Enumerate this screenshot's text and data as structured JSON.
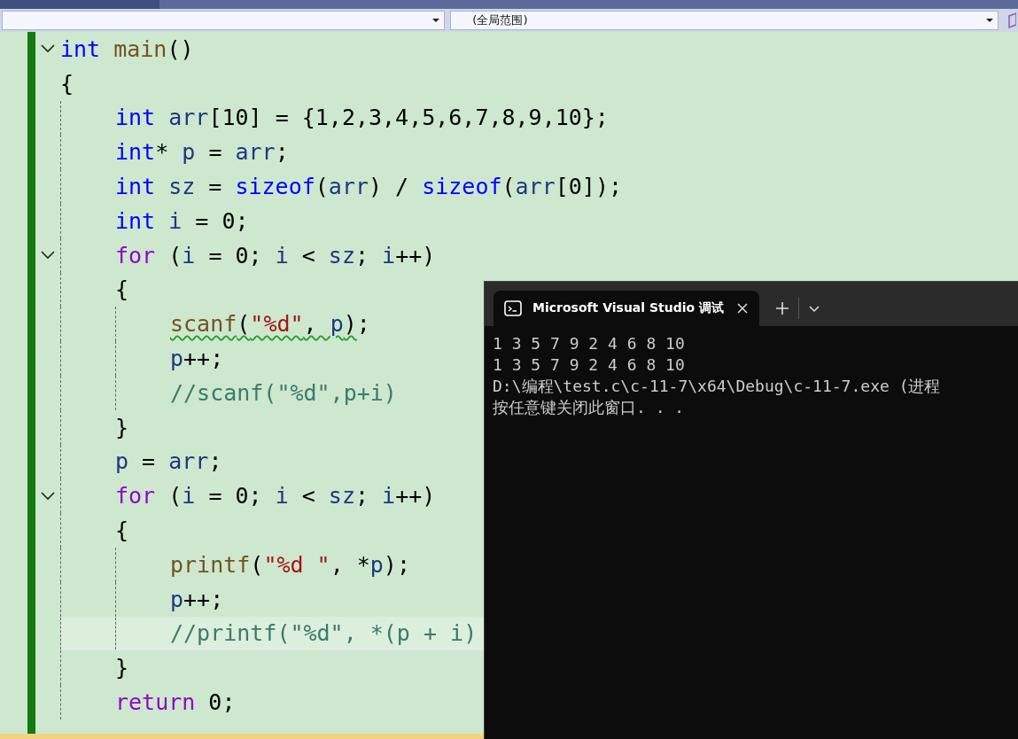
{
  "navigation_bar": {
    "scope_dropdown": {
      "value": "(全局范围)"
    }
  },
  "editor": {
    "lines": [
      {
        "fold": true,
        "current": false,
        "tokens": [
          {
            "kind": "keyword",
            "text": "int"
          },
          {
            "kind": "function",
            "text": " main"
          },
          {
            "kind": "plain",
            "text": "()"
          }
        ]
      },
      {
        "fold": false,
        "current": false,
        "tokens": [
          {
            "kind": "plain",
            "text": "{"
          }
        ],
        "children": [
          {
            "fold": false,
            "current": false,
            "tokens": [
              {
                "kind": "keyword",
                "text": "int"
              },
              {
                "kind": "variable",
                "text": " arr"
              },
              {
                "kind": "plain",
                "text": "[10] = {1,2,3,4,5,6,7,8,9,10};"
              }
            ]
          },
          {
            "fold": false,
            "current": false,
            "tokens": [
              {
                "kind": "keyword",
                "text": "int"
              },
              {
                "kind": "plain",
                "text": "* "
              },
              {
                "kind": "variable",
                "text": "p"
              },
              {
                "kind": "plain",
                "text": " = "
              },
              {
                "kind": "variable",
                "text": "arr"
              },
              {
                "kind": "plain",
                "text": ";"
              }
            ]
          },
          {
            "fold": false,
            "current": false,
            "tokens": [
              {
                "kind": "keyword",
                "text": "int"
              },
              {
                "kind": "variable",
                "text": " sz"
              },
              {
                "kind": "plain",
                "text": " = "
              },
              {
                "kind": "keyword",
                "text": "sizeof"
              },
              {
                "kind": "plain",
                "text": "("
              },
              {
                "kind": "variable",
                "text": "arr"
              },
              {
                "kind": "plain",
                "text": ") / "
              },
              {
                "kind": "keyword",
                "text": "sizeof"
              },
              {
                "kind": "plain",
                "text": "("
              },
              {
                "kind": "variable",
                "text": "arr"
              },
              {
                "kind": "plain",
                "text": "[0]);"
              }
            ]
          },
          {
            "fold": false,
            "current": false,
            "tokens": [
              {
                "kind": "keyword",
                "text": "int"
              },
              {
                "kind": "variable",
                "text": " i"
              },
              {
                "kind": "plain",
                "text": " = 0;"
              }
            ]
          },
          {
            "fold": true,
            "current": false,
            "tokens": [
              {
                "kind": "control",
                "text": "for"
              },
              {
                "kind": "plain",
                "text": " ("
              },
              {
                "kind": "variable",
                "text": "i"
              },
              {
                "kind": "plain",
                "text": " = 0; "
              },
              {
                "kind": "variable",
                "text": "i"
              },
              {
                "kind": "plain",
                "text": " < "
              },
              {
                "kind": "variable",
                "text": "sz"
              },
              {
                "kind": "plain",
                "text": "; "
              },
              {
                "kind": "variable",
                "text": "i"
              },
              {
                "kind": "plain",
                "text": "++)"
              }
            ]
          },
          {
            "fold": false,
            "current": false,
            "tokens": [
              {
                "kind": "plain",
                "text": "{"
              }
            ],
            "children": [
              {
                "fold": false,
                "current": false,
                "tokens": [
                  {
                    "kind": "function",
                    "text": "scanf",
                    "squiggle": true
                  },
                  {
                    "kind": "plain",
                    "text": "(",
                    "squiggle": true
                  },
                  {
                    "kind": "string",
                    "text": "\"%d\"",
                    "squiggle": true
                  },
                  {
                    "kind": "plain",
                    "text": ", ",
                    "squiggle": true
                  },
                  {
                    "kind": "variable",
                    "text": "p",
                    "squiggle": true
                  },
                  {
                    "kind": "plain",
                    "text": ")",
                    "squiggle": true
                  },
                  {
                    "kind": "plain",
                    "text": ";",
                    "squiggle": false
                  }
                ]
              },
              {
                "fold": false,
                "current": false,
                "tokens": [
                  {
                    "kind": "variable",
                    "text": "p"
                  },
                  {
                    "kind": "plain",
                    "text": "++;"
                  }
                ]
              },
              {
                "fold": false,
                "current": false,
                "tokens": [
                  {
                    "kind": "comment",
                    "text": "//scanf(\"%d\",p+i)"
                  }
                ]
              }
            ]
          },
          {
            "fold": false,
            "current": false,
            "tokens": [
              {
                "kind": "plain",
                "text": "}"
              }
            ]
          },
          {
            "fold": false,
            "current": false,
            "tokens": [
              {
                "kind": "variable",
                "text": "p"
              },
              {
                "kind": "plain",
                "text": " = "
              },
              {
                "kind": "variable",
                "text": "arr"
              },
              {
                "kind": "plain",
                "text": ";"
              }
            ]
          },
          {
            "fold": true,
            "current": false,
            "tokens": [
              {
                "kind": "control",
                "text": "for"
              },
              {
                "kind": "plain",
                "text": " ("
              },
              {
                "kind": "variable",
                "text": "i"
              },
              {
                "kind": "plain",
                "text": " = 0; "
              },
              {
                "kind": "variable",
                "text": "i"
              },
              {
                "kind": "plain",
                "text": " < "
              },
              {
                "kind": "variable",
                "text": "sz"
              },
              {
                "kind": "plain",
                "text": "; "
              },
              {
                "kind": "variable",
                "text": "i"
              },
              {
                "kind": "plain",
                "text": "++)"
              }
            ]
          },
          {
            "fold": false,
            "current": false,
            "tokens": [
              {
                "kind": "plain",
                "text": "{"
              }
            ],
            "children": [
              {
                "fold": false,
                "current": false,
                "tokens": [
                  {
                    "kind": "function",
                    "text": "printf"
                  },
                  {
                    "kind": "plain",
                    "text": "("
                  },
                  {
                    "kind": "string",
                    "text": "\"%d \""
                  },
                  {
                    "kind": "plain",
                    "text": ", *"
                  },
                  {
                    "kind": "variable",
                    "text": "p"
                  },
                  {
                    "kind": "plain",
                    "text": ");"
                  }
                ]
              },
              {
                "fold": false,
                "current": false,
                "tokens": [
                  {
                    "kind": "variable",
                    "text": "p"
                  },
                  {
                    "kind": "plain",
                    "text": "++;"
                  }
                ]
              },
              {
                "fold": false,
                "current": true,
                "tokens": [
                  {
                    "kind": "comment",
                    "text": "//printf(\"%d\", *(p + i)"
                  }
                ]
              }
            ]
          },
          {
            "fold": false,
            "current": false,
            "tokens": [
              {
                "kind": "plain",
                "text": "}"
              }
            ]
          },
          {
            "fold": false,
            "current": false,
            "tokens": [
              {
                "kind": "control",
                "text": "return"
              },
              {
                "kind": "plain",
                "text": " 0;"
              }
            ]
          }
        ]
      }
    ]
  },
  "console": {
    "tab": {
      "title": "Microsoft Visual Studio 调试"
    },
    "output": [
      "1 3 5 7 9 2 4 6 8 10",
      "1 3 5 7 9 2 4 6 8 10",
      "D:\\编程\\test.c\\c-11-7\\x64\\Debug\\c-11-7.exe (进程",
      "按任意键关闭此窗口. . ."
    ]
  }
}
